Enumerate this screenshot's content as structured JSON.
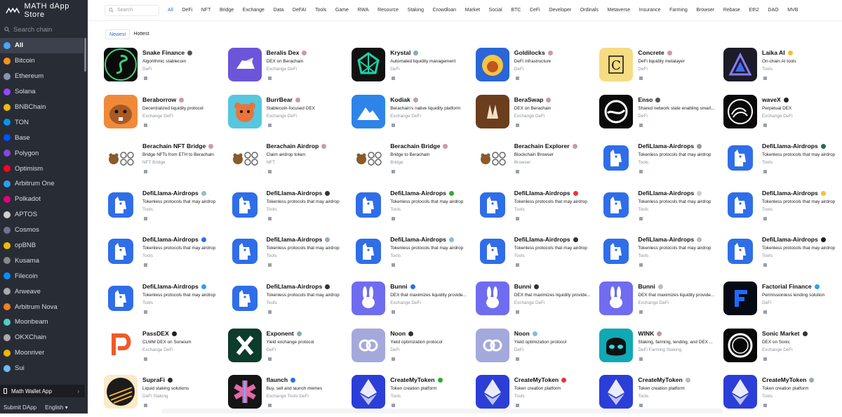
{
  "app": {
    "title": "MATH dApp Store"
  },
  "sidebar": {
    "search_placeholder": "Search chain",
    "chains": [
      {
        "label": "All",
        "color": "#4da3ff",
        "active": true
      },
      {
        "label": "Bitcoin",
        "color": "#f7931a"
      },
      {
        "label": "Ethereum",
        "color": "#8a92b2"
      },
      {
        "label": "Solana",
        "color": "#9945ff"
      },
      {
        "label": "BNBChain",
        "color": "#f0b90b"
      },
      {
        "label": "TON",
        "color": "#0098ea"
      },
      {
        "label": "Base",
        "color": "#0052ff"
      },
      {
        "label": "Polygon",
        "color": "#8247e5"
      },
      {
        "label": "Optimism",
        "color": "#ff0420"
      },
      {
        "label": "Arbitrum One",
        "color": "#28a0f0"
      },
      {
        "label": "Polkadot",
        "color": "#e6007a"
      },
      {
        "label": "APTOS",
        "color": "#d0d0d0"
      },
      {
        "label": "Cosmos",
        "color": "#6f7390"
      },
      {
        "label": "opBNB",
        "color": "#f0b90b"
      },
      {
        "label": "Kusama",
        "color": "#888"
      },
      {
        "label": "Filecoin",
        "color": "#0090ff"
      },
      {
        "label": "Arweave",
        "color": "#aaa"
      },
      {
        "label": "Arbitrum Nova",
        "color": "#ef8220"
      },
      {
        "label": "Moonbeam",
        "color": "#53cbc8"
      },
      {
        "label": "OKXChain",
        "color": "#aaa"
      },
      {
        "label": "Moonriver",
        "color": "#f2b705"
      },
      {
        "label": "Sui",
        "color": "#6fbcf0"
      }
    ],
    "wallet_app": "Math Wallet App",
    "submit": "Submit DApp",
    "language": "English ▾"
  },
  "topbar": {
    "search_placeholder": "Search",
    "tabs": [
      "All",
      "DeFi",
      "NFT",
      "Bridge",
      "Exchange",
      "Data",
      "DeFAI",
      "Tools",
      "Game",
      "RWA",
      "Resource",
      "Staking",
      "Crowdloan",
      "Market",
      "Social",
      "BTC",
      "CeFi",
      "Developer",
      "Ordinals",
      "Metaverse",
      "Insurance",
      "Farming",
      "Browser",
      "Rebase",
      "Eth2",
      "DAO",
      "MVB"
    ],
    "active_tab": "All"
  },
  "sort": {
    "newest": "Newest",
    "hottest": "Hottest"
  },
  "dapps": [
    {
      "name": "Snake Finance",
      "desc": "Algorithmic stablecoin",
      "tags": "DeFi",
      "icon": "snake-icon",
      "bg": "#0b0b0b",
      "fg": "#3fd17a",
      "badge": "#555"
    },
    {
      "name": "Beralis Dex",
      "desc": "DEX on Berachain",
      "tags": "Exchange DeFi",
      "icon": "bear-flag-icon",
      "bg": "#6c55d9",
      "fg": "#fff",
      "badge": "#c9a"
    },
    {
      "name": "Krystal",
      "desc": "Automated liquidity management",
      "tags": "DeFi",
      "icon": "krystal-icon",
      "bg": "#111",
      "fg": "#1fd1a6",
      "badge": "#8ab"
    },
    {
      "name": "Goldilocks",
      "desc": "DeFi infrastructure",
      "tags": "DeFi",
      "icon": "lion-icon",
      "bg": "#2a66d8",
      "fg": "#f4c542",
      "badge": "#c9a"
    },
    {
      "name": "Concrete",
      "desc": "DeFi liquidity metalayer",
      "tags": "DeFi",
      "icon": "c-letter-icon",
      "bg": "#f6dc82",
      "fg": "#111",
      "badge": "#c9a"
    },
    {
      "name": "Laika AI",
      "desc": "On-chain AI tools",
      "tags": "Tools",
      "icon": "triangle-icon",
      "bg": "#1c1c28",
      "fg": "#8a7bff",
      "badge": "#f2c230"
    },
    {
      "name": "Beraborrow",
      "desc": "Decentralized liquidity protocol",
      "tags": "Exchange DeFi",
      "icon": "beaver-icon",
      "bg": "#f08a3a",
      "fg": "#5a2d10",
      "badge": "#c9a"
    },
    {
      "name": "BurrBear",
      "desc": "Stablecoin-focused DEX",
      "tags": "Exchange DeFi",
      "icon": "bear-face-icon",
      "bg": "#56c7df",
      "fg": "#e8743a",
      "badge": "#c9a"
    },
    {
      "name": "Kodiak",
      "desc": "Berachain's native liquidity platform",
      "tags": "Exchange DeFi",
      "icon": "mountain-icon",
      "bg": "#2e84e8",
      "fg": "#fff",
      "badge": "#c9a"
    },
    {
      "name": "BeraSwap",
      "desc": "DEX on Berachain",
      "tags": "Exchange DeFi",
      "icon": "paw-icon",
      "bg": "#6b3e1d",
      "fg": "#f3e2c8",
      "badge": "#c9a"
    },
    {
      "name": "Enso",
      "desc": "Shared network state enabling smart...",
      "tags": "DeFi",
      "icon": "wave-circle-icon",
      "bg": "#0a0a0a",
      "fg": "#fff",
      "badge": "#555"
    },
    {
      "name": "waveX",
      "desc": "Perpetual DEX",
      "tags": "Exchange DeFi",
      "icon": "waves-icon",
      "bg": "#0a0a0a",
      "fg": "#fff",
      "badge": "#222"
    },
    {
      "name": "Berachain NFT Bridge",
      "desc": "Bridge NFTs from ETH to Berachain",
      "tags": "NFT Bridge",
      "icon": "bear-chain-icon",
      "bg": "#fff",
      "fg": "#8b5a2b",
      "badge": "#c9a"
    },
    {
      "name": "Berachain Airdrop",
      "desc": "Claim airdrop token",
      "tags": "NFT",
      "icon": "bear-chain-icon",
      "bg": "#fff",
      "fg": "#8b5a2b",
      "badge": "#c9a"
    },
    {
      "name": "Berachain Bridge",
      "desc": "Bridge to Berachain",
      "tags": "Bridge",
      "icon": "bear-chain-icon",
      "bg": "#fff",
      "fg": "#8b5a2b",
      "badge": "#c9a"
    },
    {
      "name": "Berachain Explorer",
      "desc": "Blockchain Browser",
      "tags": "Browser",
      "icon": "bear-chain-icon",
      "bg": "#fff",
      "fg": "#8b5a2b",
      "badge": "#c9a"
    },
    {
      "name": "DefiLlama-Airdrops",
      "desc": "Tokenless protocols that may airdrop",
      "tags": "Tools",
      "icon": "llama-icon",
      "bg": "#fff",
      "fg": "#2f6ee8",
      "badge": "#999"
    },
    {
      "name": "DefiLlama-Airdrops",
      "desc": "Tokenless protocols that may airdrop",
      "tags": "Tools",
      "icon": "llama-icon",
      "bg": "#fff",
      "fg": "#2f6ee8",
      "badge": "#226a5a"
    },
    {
      "name": "DefiLlama-Airdrops",
      "desc": "Tokenless protocols that may airdrop",
      "tags": "Tools",
      "icon": "llama-icon",
      "bg": "#fff",
      "fg": "#2f6ee8",
      "badge": "#9bc"
    },
    {
      "name": "DefiLlama-Airdrops",
      "desc": "Tokenless protocols that may airdrop",
      "tags": "Tools",
      "icon": "llama-icon",
      "bg": "#fff",
      "fg": "#2f6ee8",
      "badge": "#333"
    },
    {
      "name": "DefiLlama-Airdrops",
      "desc": "Tokenless protocols that may airdrop",
      "tags": "Tools",
      "icon": "llama-icon",
      "bg": "#fff",
      "fg": "#2f6ee8",
      "badge": "#3a3"
    },
    {
      "name": "DefiLlama-Airdrops",
      "desc": "Tokenless protocols that may airdrop",
      "tags": "Tools",
      "icon": "llama-icon",
      "bg": "#fff",
      "fg": "#2f6ee8",
      "badge": "#e33"
    },
    {
      "name": "DefiLlama-Airdrops",
      "desc": "Tokenless protocols that may airdrop",
      "tags": "Tools",
      "icon": "llama-icon",
      "bg": "#fff",
      "fg": "#2f6ee8",
      "badge": "#ccc"
    },
    {
      "name": "DefiLlama-Airdrops",
      "desc": "Tokenless protocols that may airdrop",
      "tags": "Tools",
      "icon": "llama-icon",
      "bg": "#fff",
      "fg": "#2f6ee8",
      "badge": "#f2c230"
    },
    {
      "name": "DefiLlama-Airdrops",
      "desc": "Tokenless protocols that may airdrop",
      "tags": "Tools",
      "icon": "llama-icon",
      "bg": "#fff",
      "fg": "#2f6ee8",
      "badge": "#2f6ee8"
    },
    {
      "name": "DefiLlama-Airdrops",
      "desc": "Tokenless protocols that may airdrop",
      "tags": "Tools",
      "icon": "llama-icon",
      "bg": "#fff",
      "fg": "#2f6ee8",
      "badge": "#9ab"
    },
    {
      "name": "DefiLlama-Airdrops",
      "desc": "Tokenless protocols that may airdrop",
      "tags": "Tools",
      "icon": "llama-icon",
      "bg": "#fff",
      "fg": "#2f6ee8",
      "badge": "#8bd"
    },
    {
      "name": "DefiLlama-Airdrops",
      "desc": "Tokenless protocols that may airdrop",
      "tags": "Tools",
      "icon": "llama-icon",
      "bg": "#fff",
      "fg": "#2f6ee8",
      "badge": "#333"
    },
    {
      "name": "DefiLlama-Airdrops",
      "desc": "Tokenless protocols that may airdrop",
      "tags": "Tools",
      "icon": "llama-icon",
      "bg": "#fff",
      "fg": "#2f6ee8",
      "badge": "#bbb"
    },
    {
      "name": "DefiLlama-Airdrops",
      "desc": "Tokenless protocols that may airdrop",
      "tags": "Tools",
      "icon": "llama-icon",
      "bg": "#fff",
      "fg": "#2f6ee8",
      "badge": "#222"
    },
    {
      "name": "DefiLlama-Airdrops",
      "desc": "Tokenless protocols that may airdrop",
      "tags": "Tools",
      "icon": "llama-icon",
      "bg": "#fff",
      "fg": "#2f6ee8",
      "badge": "#2f9ee8"
    },
    {
      "name": "DefiLlama-Airdrops",
      "desc": "Tokenless protocols that may airdrop",
      "tags": "Tools",
      "icon": "llama-icon",
      "bg": "#fff",
      "fg": "#2f6ee8",
      "badge": "#333"
    },
    {
      "name": "Bunni",
      "desc": "DEX that maximizes liquidity provide...",
      "tags": "Exchange DeFi",
      "icon": "rabbit-icon",
      "bg": "#6f6cf0",
      "fg": "#fff",
      "badge": "#2f6ee8"
    },
    {
      "name": "Bunni",
      "desc": "DEX that maximizes liquidity provide...",
      "tags": "Exchange DeFi",
      "icon": "rabbit-icon",
      "bg": "#6f6cf0",
      "fg": "#fff",
      "badge": "#333"
    },
    {
      "name": "Bunni",
      "desc": "DEX that maximizes liquidity provide...",
      "tags": "Exchange DeFi",
      "icon": "rabbit-icon",
      "bg": "#6f6cf0",
      "fg": "#fff",
      "badge": "#bbb"
    },
    {
      "name": "Factorial Finance",
      "desc": "Permissionless lending solution",
      "tags": "DeFi",
      "icon": "f-letter-icon",
      "bg": "#060a14",
      "fg": "#1f6bff",
      "badge": "#2fa0e8"
    },
    {
      "name": "PassDEX",
      "desc": "CLMM DEX on Soneium",
      "tags": "Exchange DeFi",
      "icon": "p-letter-icon",
      "bg": "#fff",
      "fg": "#f05a28",
      "badge": "#222"
    },
    {
      "name": "Exponent",
      "desc": "Yield exchange protocol",
      "tags": "DeFi",
      "icon": "x-letter-icon",
      "bg": "#0d3b2c",
      "fg": "#fff",
      "badge": "#8ab"
    },
    {
      "name": "Noon",
      "desc": "Yield optimization protocol",
      "tags": "DeFi",
      "icon": "link-icon",
      "bg": "#a4a9dc",
      "fg": "#fff",
      "badge": "#333"
    },
    {
      "name": "Noon",
      "desc": "Yield optimization protocol",
      "tags": "DeFi",
      "icon": "link-icon",
      "bg": "#a4a9dc",
      "fg": "#fff",
      "badge": "#8bd"
    },
    {
      "name": "WINK",
      "desc": "Staking, farming, lending, and DEX ...",
      "tags": "DeFi Farming Staking",
      "icon": "face-icon",
      "bg": "#10a9b4",
      "fg": "#111",
      "badge": "#b9a"
    },
    {
      "name": "Sonic Market",
      "desc": "DEX on Sonic",
      "tags": "Exchange DeFi",
      "icon": "ring-icon",
      "bg": "#070707",
      "fg": "#fff",
      "badge": "#333"
    },
    {
      "name": "SupraFi",
      "desc": "Liquid staking solutions",
      "tags": "DeFi Staking",
      "icon": "rays-icon",
      "bg": "#fbe9c7",
      "fg": "#1b1b1b",
      "badge": "#333"
    },
    {
      "name": "flaunch",
      "desc": "Buy, sell and launch memes",
      "tags": "Exchange Tools DeFi",
      "icon": "asterisk-icon",
      "bg": "#151515",
      "fg": "#e26aa8",
      "badge": "#2f6ee8"
    },
    {
      "name": "CreateMyToken",
      "desc": "Token creation platform",
      "tags": "Tools",
      "icon": "ethereum-icon",
      "bg": "#2b3ed8",
      "fg": "#fff",
      "badge": "#3a3"
    },
    {
      "name": "CreateMyToken",
      "desc": "Token creation platform",
      "tags": "Tools",
      "icon": "ethereum-icon",
      "bg": "#2b3ed8",
      "fg": "#fff",
      "badge": "#e33"
    },
    {
      "name": "CreateMyToken",
      "desc": "Token creation platform",
      "tags": "Tools",
      "icon": "ethereum-icon",
      "bg": "#2b3ed8",
      "fg": "#fff",
      "badge": "#bbb"
    },
    {
      "name": "CreateMyToken",
      "desc": "Token creation platform",
      "tags": "Tools",
      "icon": "ethereum-icon",
      "bg": "#2b3ed8",
      "fg": "#fff",
      "badge": "#9ab"
    }
  ]
}
